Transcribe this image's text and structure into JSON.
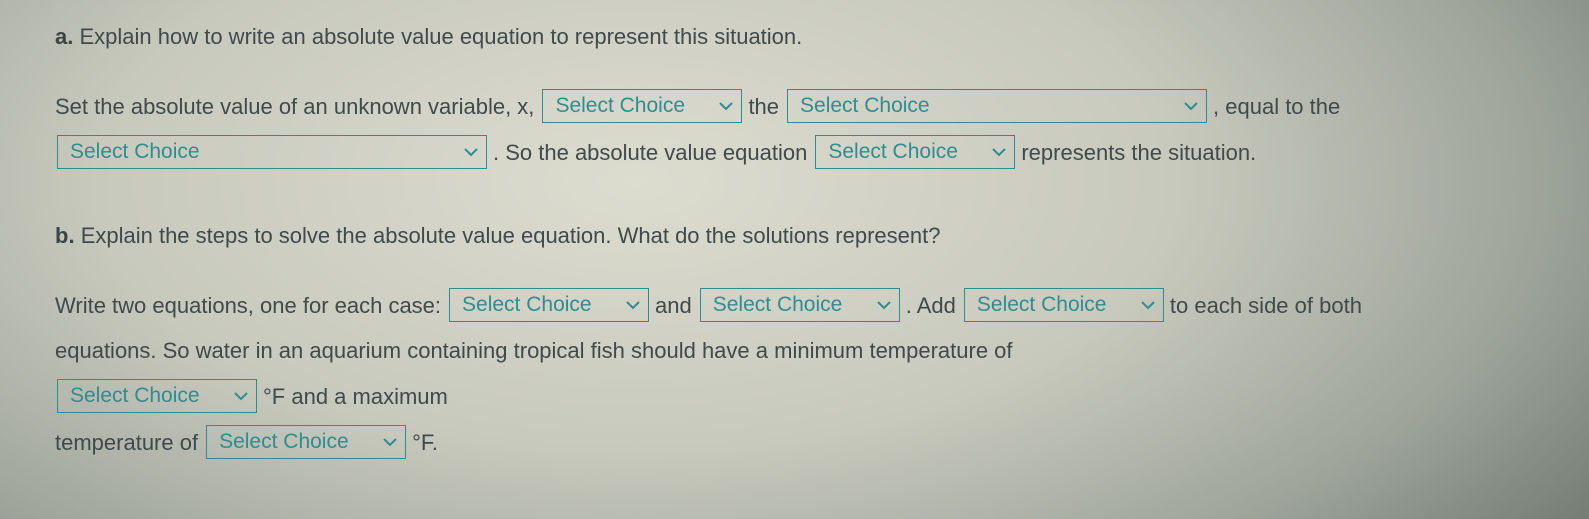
{
  "chevron_color": "#2f8d92",
  "partA": {
    "label": "a.",
    "prompt": "Explain how to write an absolute value equation to represent this situation.",
    "t1": "Set the absolute value of an unknown variable, x,",
    "s1": "Select Choice",
    "t2": "the",
    "s2": "Select Choice",
    "t3": ", equal to the",
    "s3": "Select Choice",
    "t4": ". So the absolute value equation",
    "s4": "Select Choice",
    "t5": "represents the situation."
  },
  "partB": {
    "label": "b.",
    "prompt": "Explain the steps to solve the absolute value equation. What do the solutions represent?",
    "t1": "Write two equations, one for each case:",
    "s1": "Select Choice",
    "t2": "and",
    "s2": "Select Choice",
    "t3": ". Add",
    "s3": "Select Choice",
    "t4": "to each side of both",
    "t5": "equations. So water in an aquarium containing tropical fish should have a minimum temperature of",
    "s4": "Select Choice",
    "t6": "°F and a maximum",
    "t7": "temperature of",
    "s5": "Select Choice",
    "t8": "°F."
  }
}
